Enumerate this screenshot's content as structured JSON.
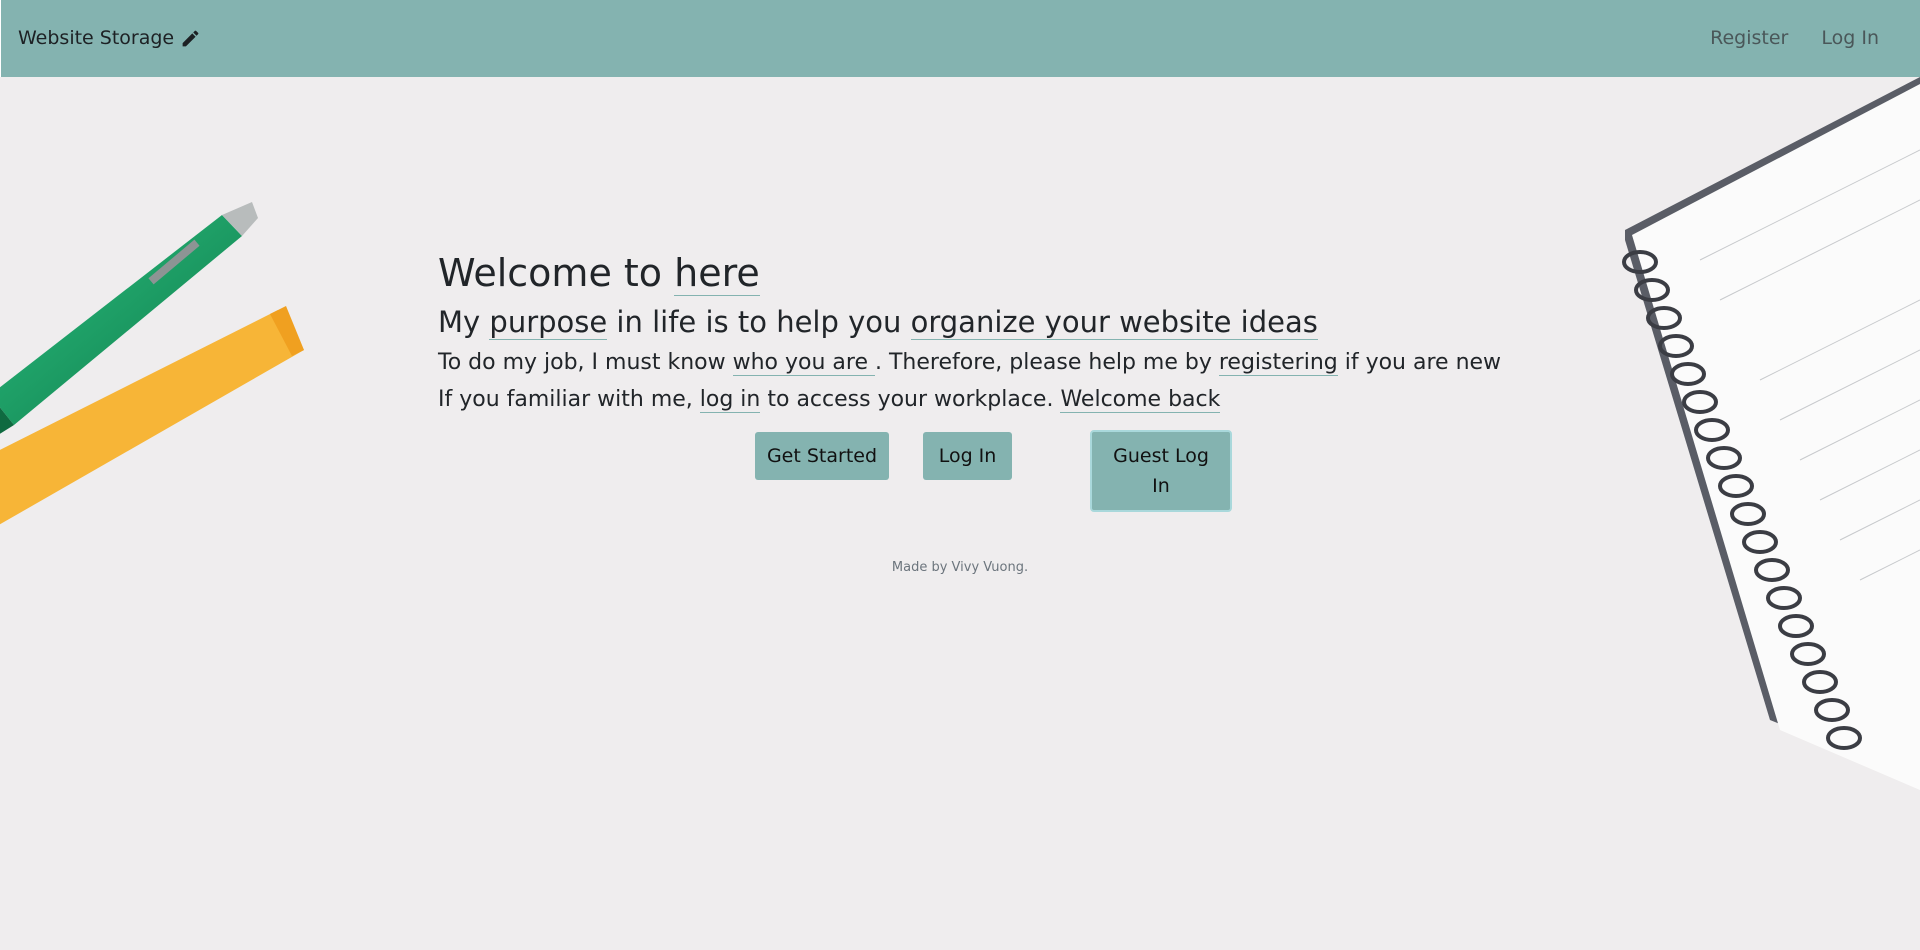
{
  "navbar": {
    "brand": "Website Storage",
    "brand_icon": "pencil-icon",
    "links": [
      "Register",
      "Log In"
    ]
  },
  "hero": {
    "title_prefix": "Welcome to ",
    "title_link": "here",
    "subtitle_prefix": "My ",
    "subtitle_link1": "purpose",
    "subtitle_mid": " in life is to help you ",
    "subtitle_link2": "organize your website ideas",
    "line1_prefix": "To do my job, I must know ",
    "line1_link1": "who you are ",
    "line1_mid": ". Therefore, please help me by ",
    "line1_link2": "registering",
    "line1_suffix": " if you are new",
    "line2_prefix": "If you familiar with me, ",
    "line2_link1": "log in",
    "line2_mid": " to access your workplace. ",
    "line2_link2": "Welcome back"
  },
  "buttons": {
    "get_started": "Get Started",
    "log_in": "Log In",
    "guest_log_in": "Guest Log In"
  },
  "footer": {
    "text": "Made by Vivy Vuong."
  },
  "colors": {
    "accent": "#84b3b0",
    "background": "#efedee"
  }
}
